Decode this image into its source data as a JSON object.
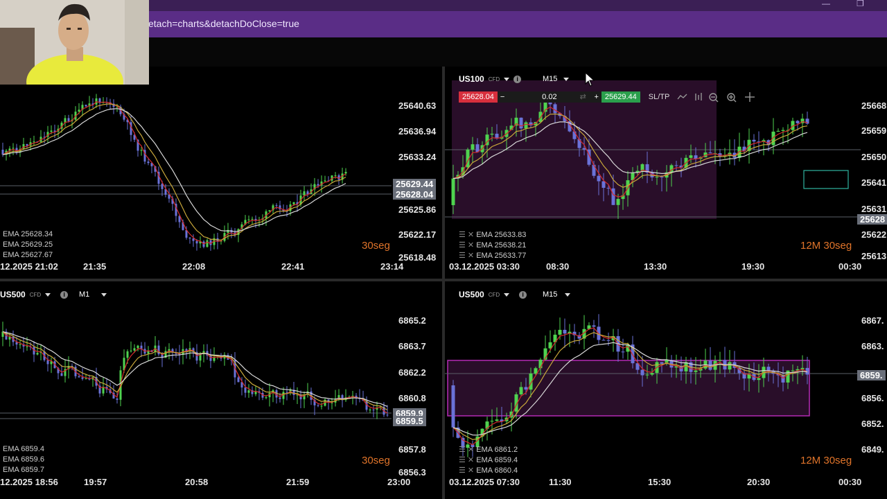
{
  "browser": {
    "url_text": "etach=charts&detachDoClose=true",
    "minimize_glyph": "—",
    "restore_glyph": "❐"
  },
  "charts": {
    "top_left": {
      "price_labels": [
        "25640.63",
        "25636.94",
        "25633.24",
        "25625.86",
        "25622.17",
        "25618.48"
      ],
      "price_tag_ask": "25629.44",
      "price_tag_bid": "25628.04",
      "time_labels": [
        "12.2025 21:02",
        "21:35",
        "22:08",
        "22:41",
        "23:14"
      ],
      "ema_lines": [
        "EMA 25628.34",
        "EMA 25629.25",
        "EMA 25627.67"
      ],
      "countdown": "30seg"
    },
    "top_right": {
      "symbol": "US100",
      "symbol_type": "CFD",
      "timeframe": "M15",
      "sell_price": "25628.04",
      "buy_price": "25629.44",
      "quantity": "0.02",
      "minus": "−",
      "plus": "+",
      "sltp": "SL/TP",
      "price_labels": [
        "25668",
        "25659",
        "25650",
        "25641",
        "25631",
        "25622",
        "25613"
      ],
      "price_tag": "25628",
      "time_labels": [
        "03.12.2025 03:30",
        "08:30",
        "13:30",
        "19:30",
        "00:30"
      ],
      "ema_lines": [
        "EMA 25633.83",
        "EMA 25638.21",
        "EMA 25633.77"
      ],
      "countdown": "12M 30seg"
    },
    "bottom_left": {
      "symbol": "US500",
      "symbol_type": "CFD",
      "timeframe": "M1",
      "price_labels": [
        "6865.2",
        "6863.7",
        "6862.2",
        "6860.8",
        "6857.8",
        "6856.3"
      ],
      "price_tag_ask": "6859.9",
      "price_tag_bid": "6859.5",
      "time_labels": [
        "12.2025 18:56",
        "19:57",
        "20:58",
        "21:59",
        "23:00"
      ],
      "ema_lines": [
        "EMA 6859.4",
        "EMA 6859.6",
        "EMA 6859.7"
      ],
      "countdown": "30seg"
    },
    "bottom_right": {
      "symbol": "US500",
      "symbol_type": "CFD",
      "timeframe": "M15",
      "price_labels": [
        "6867.",
        "6863.",
        "6859.",
        "6856.",
        "6852.",
        "6849."
      ],
      "price_tag": "6859.",
      "time_labels": [
        "03.12.2025 07:30",
        "11:30",
        "15:30",
        "20:30",
        "00:30"
      ],
      "ema_lines": [
        "EMA 6861.2",
        "EMA 6859.4",
        "EMA 6860.4"
      ],
      "countdown": "12M 30seg"
    }
  },
  "colors": {
    "bull": "#4fd34f",
    "bear": "#6a72d8",
    "ema_fast": "#d42a2a",
    "ema_mid": "#c9a83a",
    "ema_slow": "#d8d8d8",
    "zone": "#4a1a4a"
  }
}
